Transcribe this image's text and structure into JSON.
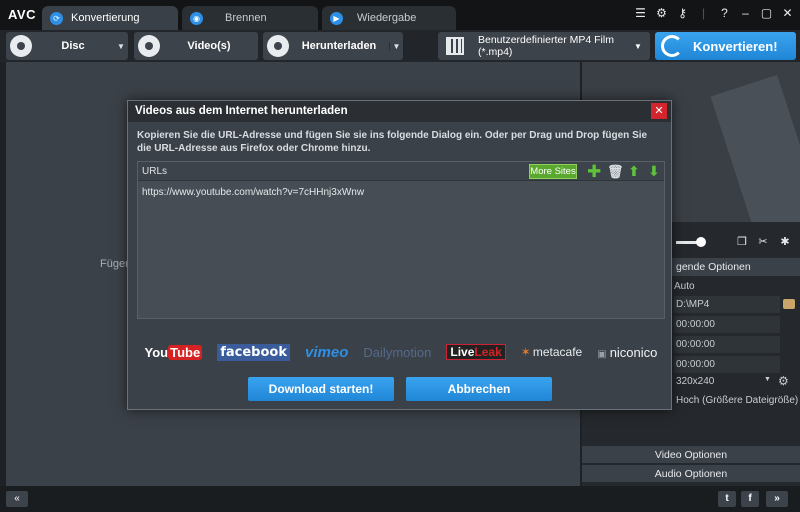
{
  "app": {
    "logo": "AVC"
  },
  "tabs": [
    {
      "label": "Konvertierung",
      "active": true
    },
    {
      "label": "Brennen",
      "active": false
    },
    {
      "label": "Wiedergabe",
      "active": false
    }
  ],
  "toolbar": {
    "disc": "Disc",
    "videos": "Video(s)",
    "download": "Herunterladen",
    "format": "Benutzerdefinierter MP4 Film (*.mp4)",
    "convert": "Konvertieren!"
  },
  "main": {
    "hint": "Fügen"
  },
  "right_panel": {
    "options_header": "gende Optionen",
    "rows": [
      {
        "value": "Auto"
      },
      {
        "value": "D:\\MP4"
      },
      {
        "value": "00:00:00"
      },
      {
        "value": "00:00:00"
      },
      {
        "value": "00:00:00"
      },
      {
        "value": "320x240"
      },
      {
        "value": "Hoch (Größere Dateigröße)"
      }
    ],
    "video_options": "Video Optionen",
    "audio_options": "Audio Optionen"
  },
  "dialog": {
    "title": "Videos aus dem Internet herunterladen",
    "close": "✕",
    "description": "Kopieren Sie die URL-Adresse und fügen Sie sie ins folgende Dialog ein. Oder per Drag und Drop fügen Sie die URL-Adresse aus Firefox oder Chrome hinzu.",
    "urls_label": "URLs",
    "more_sites": "More Sites",
    "url_value": "https://www.youtube.com/watch?v=7cHHnj3xWnw",
    "sites": {
      "you": "You",
      "tube": "Tube",
      "facebook": "facebook",
      "vimeo": "vimeo",
      "dailymotion": "Dailymotion",
      "live": "Live",
      "leak": "Leak",
      "metacafe": "metacafe",
      "niconico": "niconico"
    },
    "start": "Download starten!",
    "cancel": "Abbrechen"
  },
  "colors": {
    "accent": "#2e8fe6",
    "close": "#d3252b",
    "more_sites": "#5aa82e"
  },
  "icons": [
    "menu-icon",
    "gear-icon",
    "key-icon",
    "help-icon",
    "minimize-icon",
    "maximize-icon",
    "close-icon",
    "plus-icon",
    "trash-icon",
    "arrow-up-icon",
    "arrow-down-icon"
  ]
}
